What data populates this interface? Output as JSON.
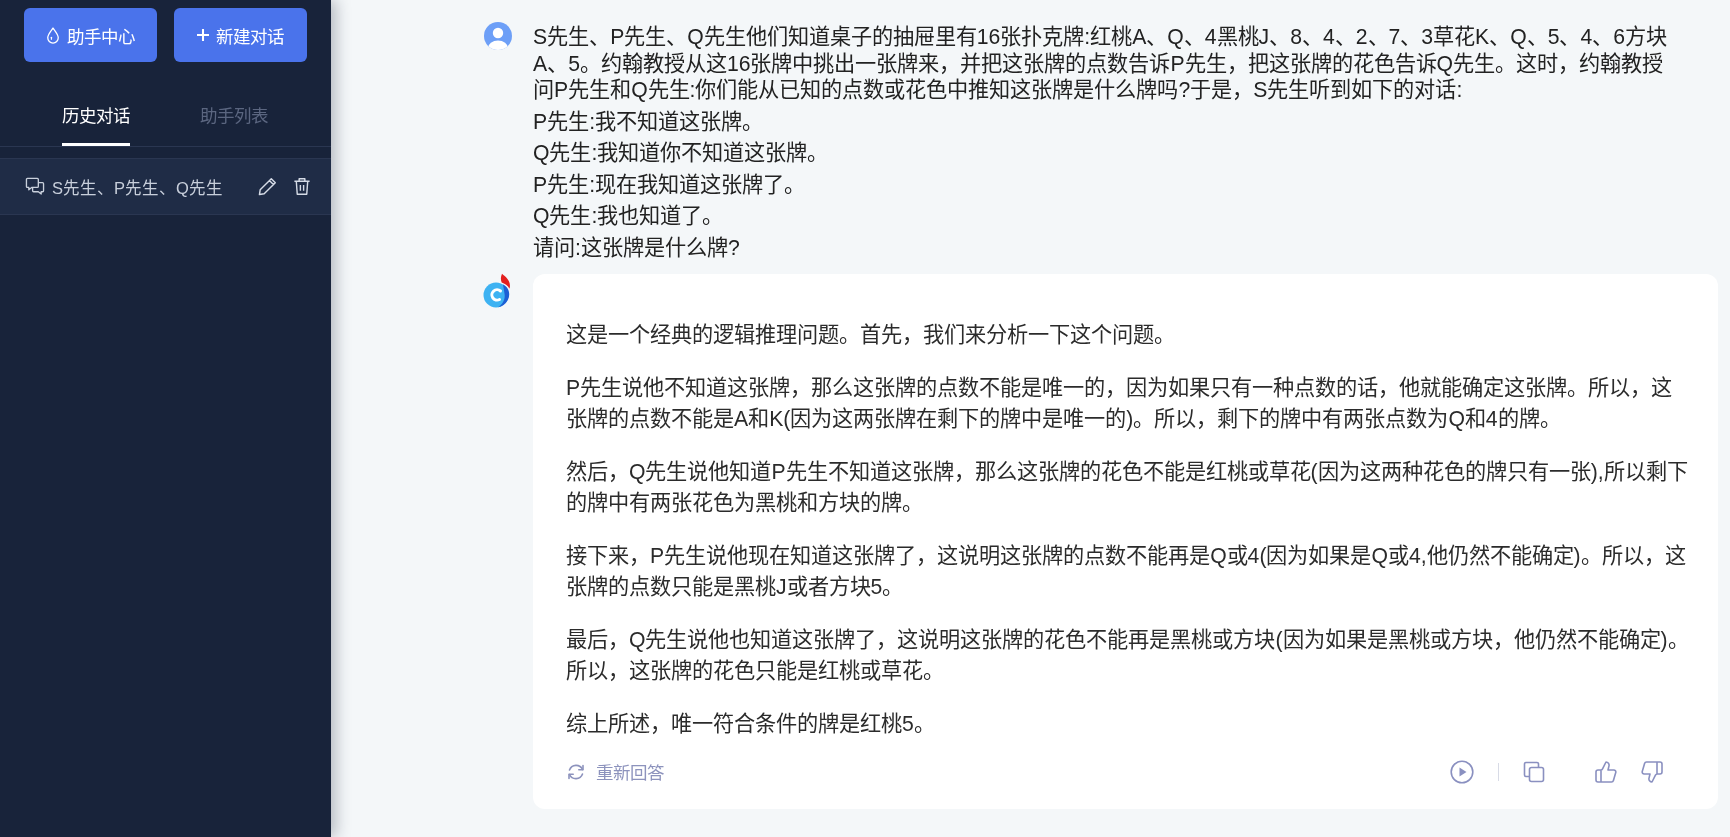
{
  "sidebar": {
    "buttons": [
      {
        "kind": "assistant",
        "label": "助手中心"
      },
      {
        "kind": "new",
        "label": "新建对话"
      }
    ],
    "tabs": [
      {
        "label": "历史对话",
        "selected": true
      },
      {
        "label": "助手列表",
        "selected": false
      }
    ],
    "history": [
      {
        "title": "S先生、P先生、Q先生",
        "selected": true
      }
    ]
  },
  "conversation": {
    "messages": [
      {
        "kind": "user",
        "lines": [
          "S先生、P先生、Q先生他们知道桌子的抽屉里有16张扑克牌:红桃A、Q、4黑桃J、8、4、2、7、3草花K、Q、5、4、6方块A、5。约翰教授从这16张牌中挑出一张牌来，并把这张牌的点数告诉P先生，把这张牌的花色告诉Q先生。这时，约翰教授问P先生和Q先生:你们能从已知的点数或花色中推知这张牌是什么牌吗?于是，S先生听到如下的对话:",
          "P先生:我不知道这张牌。",
          "Q先生:我知道你不知道这张牌。",
          "P先生:现在我知道这张牌了。",
          "Q先生:我也知道了。",
          "请问:这张牌是什么牌?"
        ]
      },
      {
        "kind": "assistant",
        "paragraphs": [
          "这是一个经典的逻辑推理问题。首先，我们来分析一下这个问题。",
          "P先生说他不知道这张牌，那么这张牌的点数不能是唯一的，因为如果只有一种点数的话，他就能确定这张牌。所以，这张牌的点数不能是A和K(因为这两张牌在剩下的牌中是唯一的)。所以，剩下的牌中有两张点数为Q和4的牌。",
          "然后，Q先生说他知道P先生不知道这张牌，那么这张牌的花色不能是红桃或草花(因为这两种花色的牌只有一张),所以剩下的牌中有两张花色为黑桃和方块的牌。",
          "接下来，P先生说他现在知道这张牌了，这说明这张牌的点数不能再是Q或4(因为如果是Q或4,他仍然不能确定)。所以，这张牌的点数只能是黑桃J或者方块5。",
          "最后，Q先生说他也知道这张牌了，这说明这张牌的花色不能再是黑桃或方块(因为如果是黑桃或方块，他仍然不能确定)。所以，这张牌的花色只能是红桃或草花。",
          "综上所述，唯一符合条件的牌是红桃5。"
        ],
        "regenerate": "重新回答"
      }
    ]
  }
}
